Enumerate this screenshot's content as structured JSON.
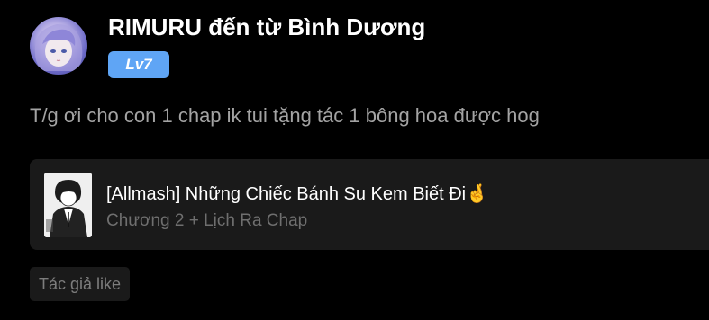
{
  "comment": {
    "author": {
      "name": "RIMURU đến từ Bình Dương",
      "level": "Lv7",
      "avatar_icon": "avatar-anime-girl"
    },
    "text": "T/g ơi cho con 1 chap ik tui tặng tác 1 bông hoa được hog",
    "story_card": {
      "title": "[Allmash] Những Chiếc Bánh Su Kem Biết Đi🤞",
      "subtitle": "Chương 2 + Lịch Ra Chap",
      "cover_icon": "manga-cover"
    },
    "reaction_tag": "Tác giả like"
  },
  "colors": {
    "background": "#000000",
    "badge": "#5fa5f5",
    "card": "#1a1a1a",
    "muted_text": "#a3a3a3"
  }
}
